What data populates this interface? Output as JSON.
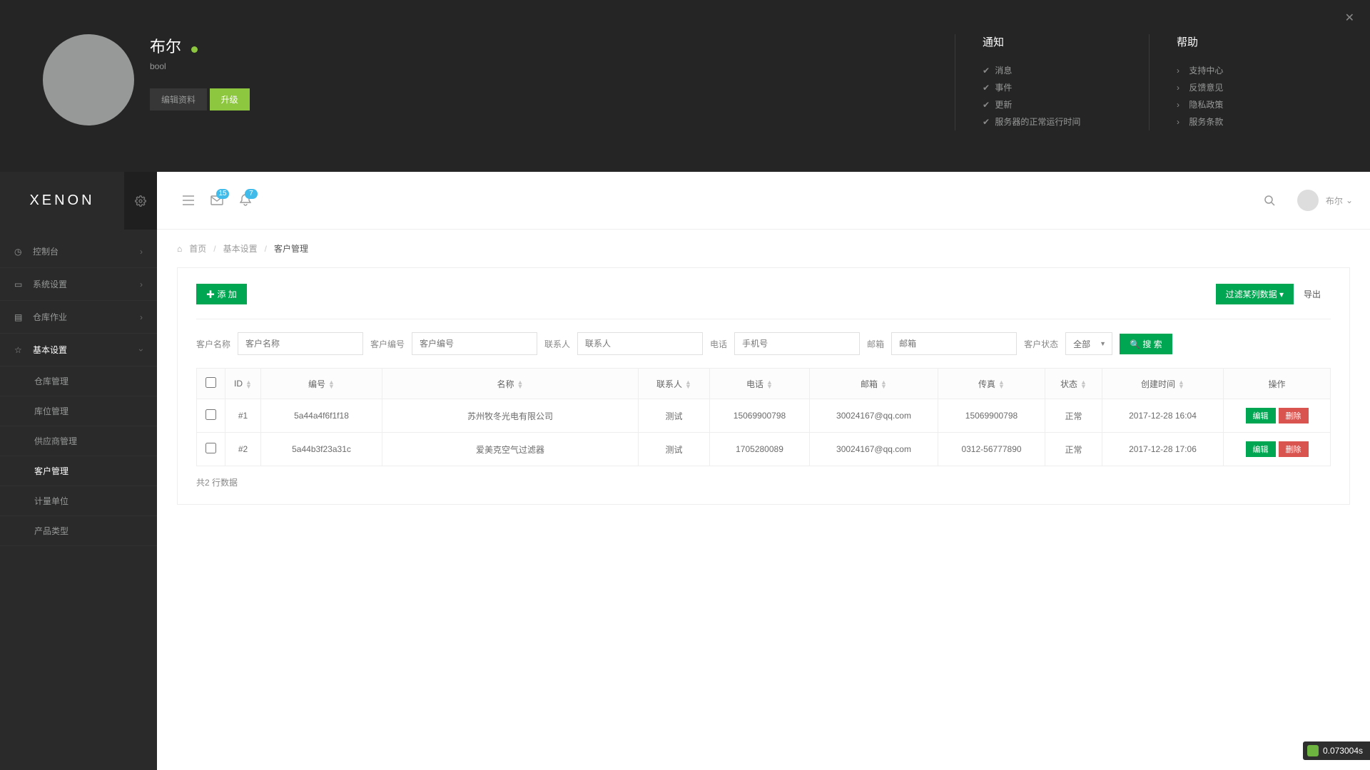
{
  "profile": {
    "display_name": "布尔",
    "login": "bool",
    "edit_btn": "编辑资料",
    "upgrade_btn": "升级"
  },
  "notify_col": {
    "title": "通知",
    "items": [
      "消息",
      "事件",
      "更新",
      "服务器的正常运行时间"
    ]
  },
  "help_col": {
    "title": "帮助",
    "items": [
      "支持中心",
      "反馈意见",
      "隐私政策",
      "服务条款"
    ]
  },
  "brand": "XENON",
  "topbar": {
    "mail_badge": "15",
    "bell_badge": "7",
    "user_name": "布尔"
  },
  "sidebar": {
    "main": [
      {
        "label": "控制台",
        "has_children": true
      },
      {
        "label": "系统设置",
        "has_children": true
      },
      {
        "label": "仓库作业",
        "has_children": true
      },
      {
        "label": "基本设置",
        "has_children": true,
        "expanded": true
      }
    ],
    "sub": [
      {
        "label": "仓库管理"
      },
      {
        "label": "库位管理"
      },
      {
        "label": "供应商管理"
      },
      {
        "label": "客户管理",
        "active": true
      },
      {
        "label": "计量单位"
      },
      {
        "label": "产品类型"
      }
    ]
  },
  "crumbs": {
    "home": "首页",
    "mid": "基本设置",
    "cur": "客户管理"
  },
  "toolbar": {
    "add": "添 加",
    "filter": "过滤某列数据",
    "export": "导出"
  },
  "filters": {
    "name_lbl": "客户名称",
    "name_ph": "客户名称",
    "code_lbl": "客户编号",
    "code_ph": "客户编号",
    "contact_lbl": "联系人",
    "contact_ph": "联系人",
    "phone_lbl": "电话",
    "phone_ph": "手机号",
    "email_lbl": "邮箱",
    "email_ph": "邮箱",
    "status_lbl": "客户状态",
    "status_val": "全部",
    "search_btn": "搜 索"
  },
  "table": {
    "headers": {
      "id": "ID",
      "code": "编号",
      "name": "名称",
      "contact": "联系人",
      "phone": "电话",
      "email": "邮箱",
      "fax": "传真",
      "status": "状态",
      "created": "创建时间",
      "ops": "操作"
    },
    "rows": [
      {
        "id": "#1",
        "code": "5a44a4f6f1f18",
        "name": "苏州牧冬光电有限公司",
        "contact": "测试",
        "phone": "15069900798",
        "email": "30024167@qq.com",
        "fax": "15069900798",
        "status": "正常",
        "created": "2017-12-28 16:04"
      },
      {
        "id": "#2",
        "code": "5a44b3f23a31c",
        "name": "爱美克空气过滤器",
        "contact": "测试",
        "phone": "1705280089",
        "email": "30024167@qq.com",
        "fax": "0312-56777890",
        "status": "正常",
        "created": "2017-12-28 17:06"
      }
    ],
    "edit_btn": "编辑",
    "del_btn": "删除",
    "summary": "共2 行数据"
  },
  "perf": "0.073004s"
}
